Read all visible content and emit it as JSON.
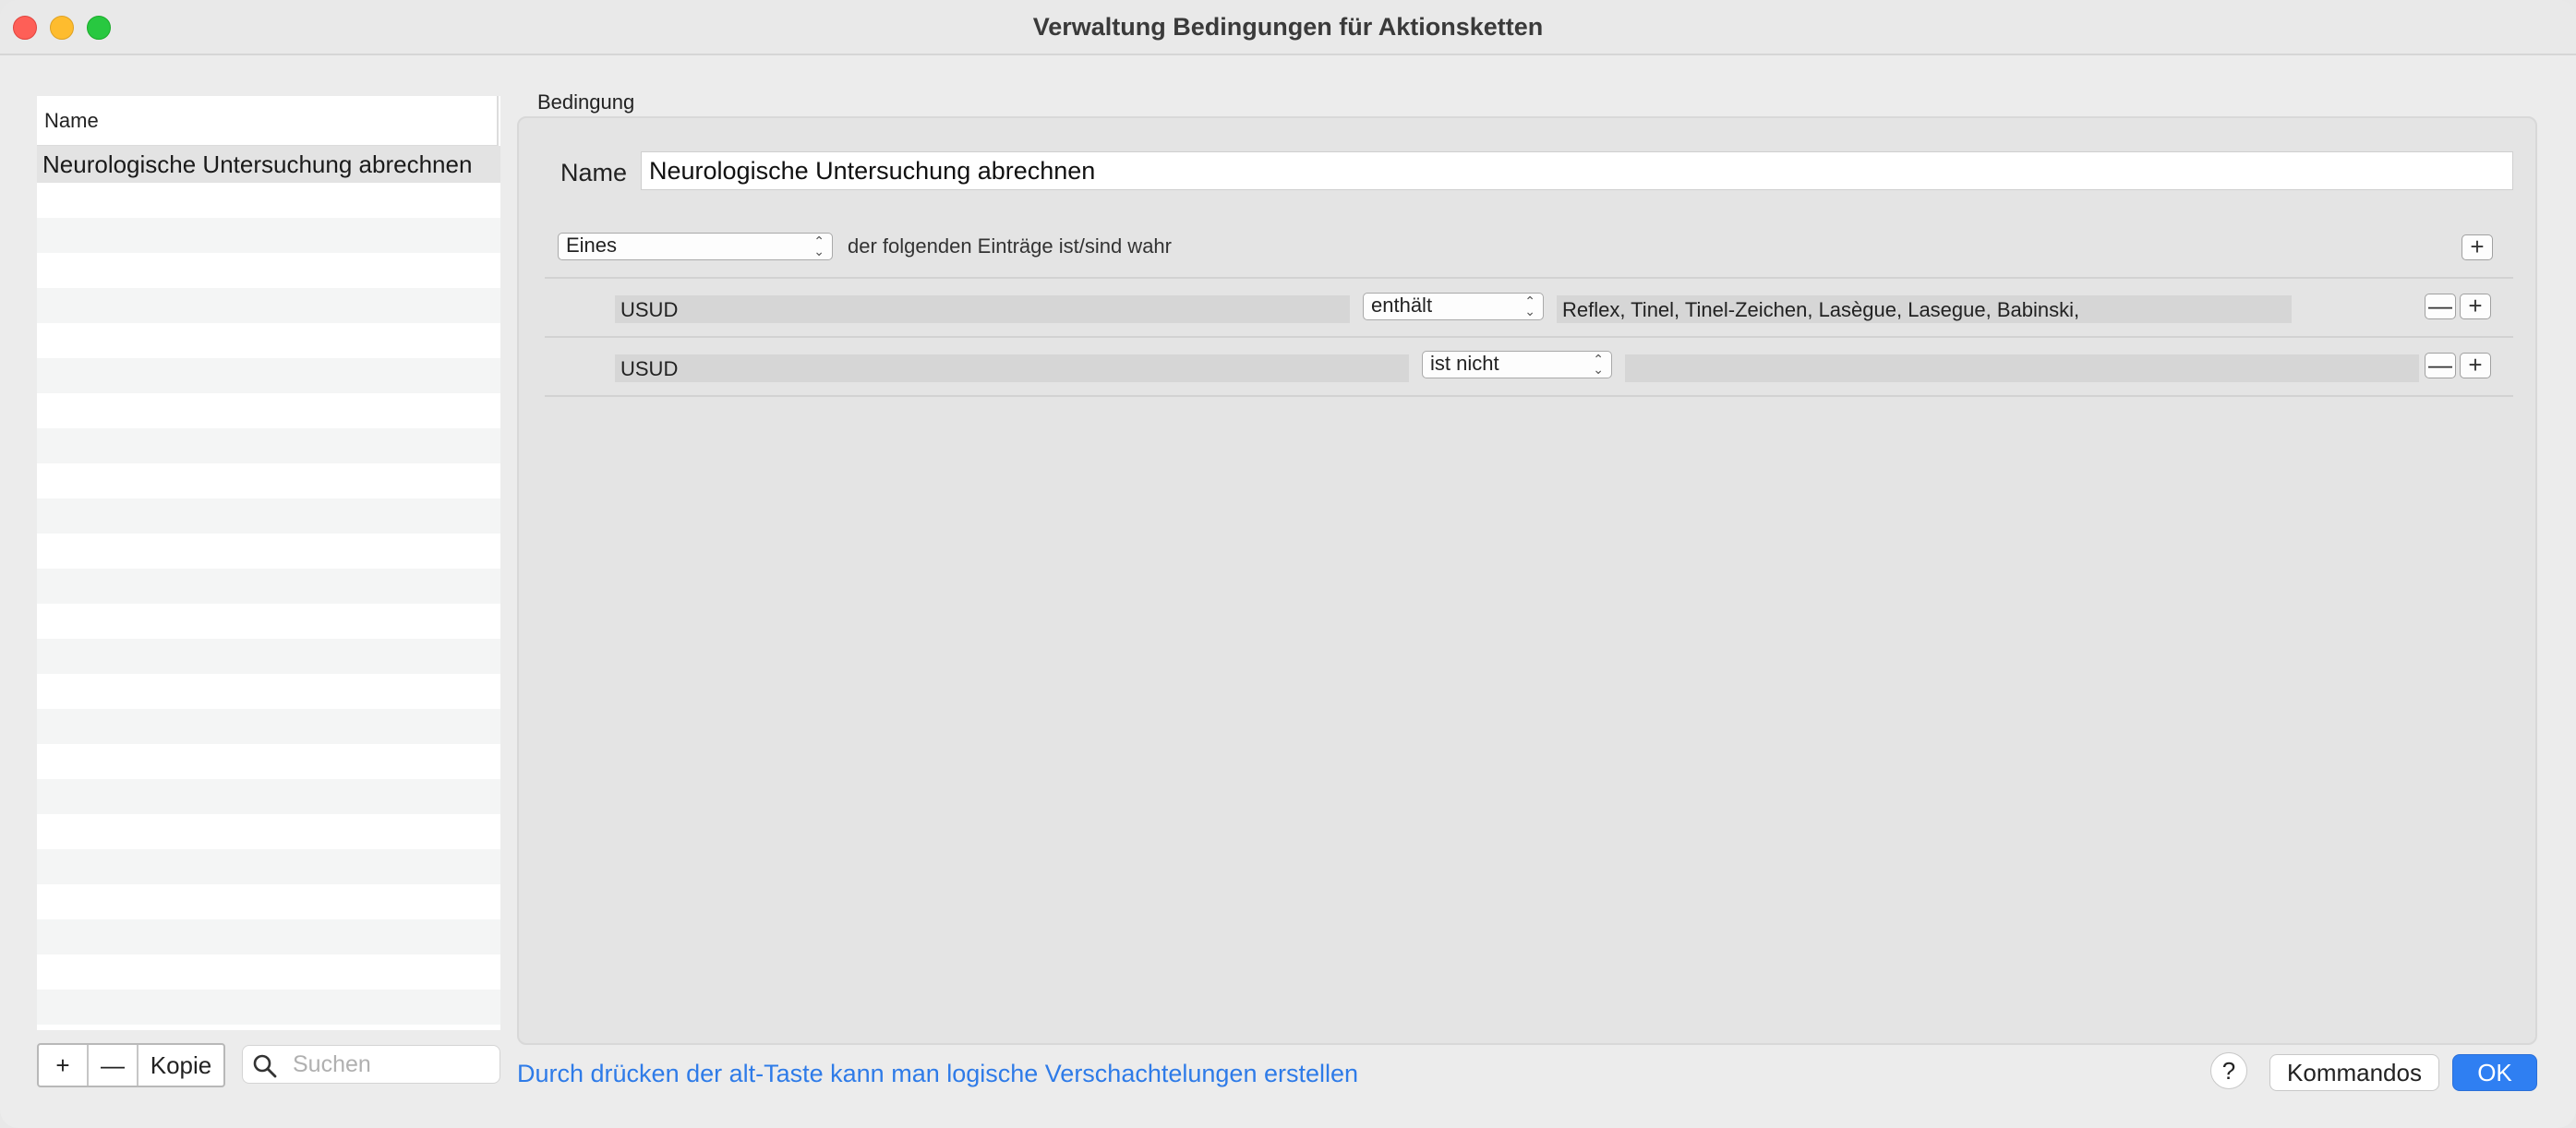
{
  "window": {
    "title": "Verwaltung Bedingungen für Aktionsketten"
  },
  "list": {
    "header": "Name",
    "selected_item": "Neurologische Untersuchung abrechnen",
    "buttons": {
      "add": "+",
      "remove": "—",
      "copy": "Kopie"
    },
    "search_placeholder": "Suchen"
  },
  "condition": {
    "group_label": "Bedingung",
    "name_label": "Name",
    "name_value": "Neurologische Untersuchung abrechnen",
    "match_mode": "Eines",
    "match_text": "der folgenden Einträge ist/sind wahr",
    "add_symbol": "+",
    "remove_symbol": "—",
    "rules": [
      {
        "field": "USUD",
        "operator": "enthält",
        "value": "Reflex, Tinel, Tinel-Zeichen, Lasègue, Lasegue, Babinski,"
      },
      {
        "field": "USUD",
        "operator": "ist nicht",
        "value": ""
      }
    ]
  },
  "footer": {
    "hint": "Durch drücken der alt-Taste kann man logische Verschachtelungen erstellen",
    "help": "?",
    "kommandos": "Kommandos",
    "ok": "OK"
  }
}
